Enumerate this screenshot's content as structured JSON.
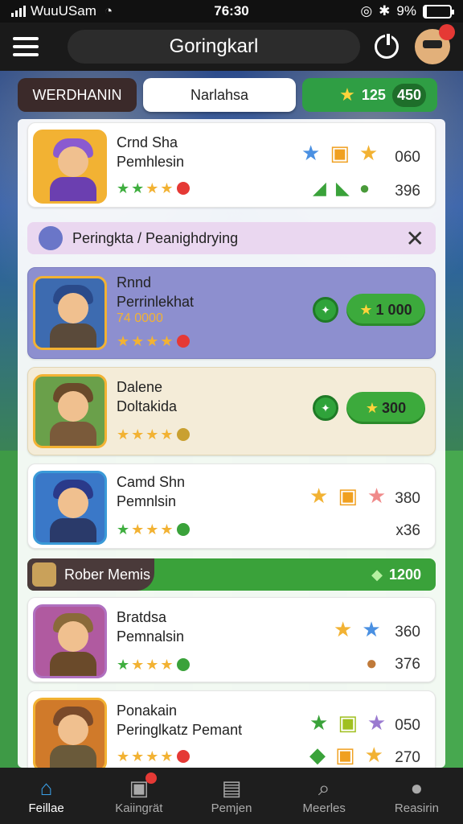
{
  "status_bar": {
    "carrier": "WuuUSam",
    "time": "76:30",
    "battery": "9%",
    "battery_level": 0.09
  },
  "header": {
    "title": "Goringkarl"
  },
  "tabs": [
    {
      "label": "WERDHANIN"
    },
    {
      "label": "Narlahsa"
    },
    {
      "label": "125",
      "extra": "450"
    }
  ],
  "cards": [
    {
      "name1": "Crnd Sha",
      "name2": "Pemhlesin",
      "value1": "060",
      "value2": "396"
    },
    {
      "name1": "Rnnd",
      "name2": "Perrinlekhat",
      "subtitle": "74 0000",
      "button": "1 000"
    },
    {
      "name1": "Dalene",
      "name2": "Doltakida",
      "button": "300"
    },
    {
      "name1": "Camd Shn",
      "name2": "Pemnlsin",
      "value1": "380",
      "value2": "x36"
    },
    {
      "name1": "Bratdsa",
      "name2": "Pemnalsin",
      "value1": "360",
      "value2": "376"
    },
    {
      "name1": "Ponakain",
      "name2": "Peringlkatz Pemant",
      "value1": "050",
      "value2": "270"
    }
  ],
  "banner_info": {
    "label": "Peringkta / Peanighdrying"
  },
  "banner_reward": {
    "label": "Rober Memis",
    "amount": "1200"
  },
  "nav": [
    {
      "label": "Feillae"
    },
    {
      "label": "Kaiingrät"
    },
    {
      "label": "Pemjen"
    },
    {
      "label": "Meerles"
    },
    {
      "label": "Reasirin"
    }
  ]
}
